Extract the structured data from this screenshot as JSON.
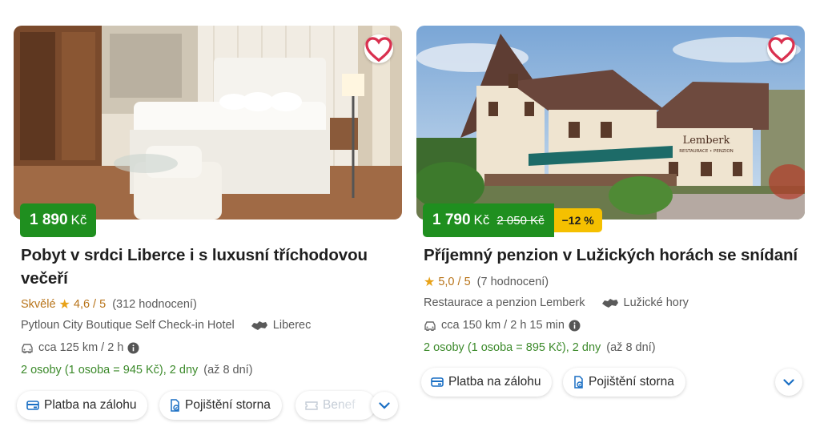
{
  "listings": [
    {
      "price": "1 890",
      "currency": "Kč",
      "title": "Pobyt v srdci Liberce i s luxusní tříchodovou večeří",
      "rating_word": "Skvělé",
      "rating": "4,6 / 5",
      "reviews": "(312 hodnocení)",
      "hotel": "Pytloun City Boutique Self Check-in Hotel",
      "region": "Liberec",
      "distance": "cca 125 km / 2 h",
      "persons": "2 osoby (1 osoba = 945 Kč), 2 dny",
      "max_days": "(až 8 dní)",
      "chips": [
        "Platba na zálohu",
        "Pojištění storna",
        "Benef"
      ]
    },
    {
      "price": "1 790",
      "currency": "Kč",
      "old_price": "2 050 Kč",
      "discount": "−12 %",
      "title": "Příjemný penzion v Lužických horách se snídaní",
      "rating": "5,0 / 5",
      "reviews": "(7 hodnocení)",
      "hotel": "Restaurace a penzion Lemberk",
      "region": "Lužické hory",
      "distance": "cca 150 km / 2 h 15 min",
      "persons": "2 osoby (1 osoba = 895 Kč), 2 dny",
      "max_days": "(až 8 dní)",
      "chips": [
        "Platba na zálohu",
        "Pojištění storna"
      ],
      "building_sign": "Lemberk",
      "building_subsign": "RESTAURACE • PENZION"
    }
  ],
  "colors": {
    "price_green": "#1f8f1f",
    "discount_yellow": "#f5c000",
    "accent_blue": "#1a6fc4",
    "heart": "#d9304f"
  },
  "icons": [
    "heart-icon",
    "star-icon",
    "map-region-icon",
    "car-icon",
    "info-icon",
    "payment-icon",
    "insurance-icon",
    "voucher-icon",
    "chevron-down-icon"
  ]
}
